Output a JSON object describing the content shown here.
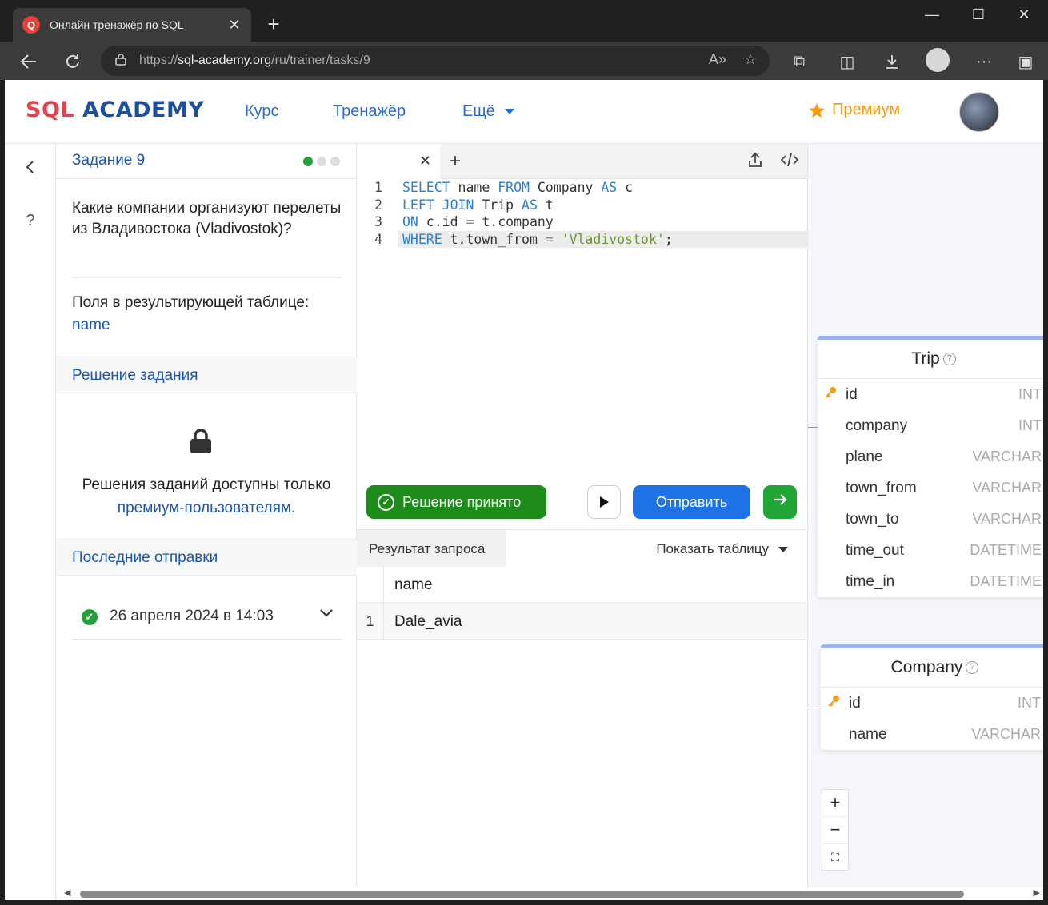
{
  "browser": {
    "tab_title": "Онлайн тренажёр по SQL",
    "url_prefix": "https://",
    "url_host": "sql-academy.org",
    "url_path": "/ru/trainer/tasks/9"
  },
  "header": {
    "logo_sql": "SQL",
    "logo_academy": "ACADEMY",
    "nav": {
      "course": "Курс",
      "trainer": "Тренажёр",
      "more": "Ещё"
    },
    "premium": "Премиум"
  },
  "rail": {
    "help": "?"
  },
  "task": {
    "title": "Задание 9",
    "progress": {
      "solved": 1,
      "total": 3
    },
    "question": "Какие компании организуют перелеты из Владивостока (Vladivostok)?",
    "fields_label": "Поля в результирующей таблице:",
    "fields_value": "name",
    "solution_header": "Решение задания",
    "premium_note_line1": "Решения заданий доступны только",
    "premium_note_link": "премиум-пользователям.",
    "recent_header": "Последние отправки",
    "submission_date": "26 апреля 2024 в 14:03"
  },
  "editor": {
    "lines": [
      {
        "n": "1",
        "tokens": [
          [
            "kw",
            "SELECT"
          ],
          [
            "t",
            " name "
          ],
          [
            "kw",
            "FROM"
          ],
          [
            "t",
            " Company "
          ],
          [
            "kw",
            "AS"
          ],
          [
            "t",
            " c"
          ]
        ]
      },
      {
        "n": "2",
        "tokens": [
          [
            "kw",
            "LEFT JOIN"
          ],
          [
            "t",
            " Trip "
          ],
          [
            "kw",
            "AS"
          ],
          [
            "t",
            " t"
          ]
        ]
      },
      {
        "n": "3",
        "tokens": [
          [
            "kw",
            "ON"
          ],
          [
            "t",
            " c.id "
          ],
          [
            "op",
            "="
          ],
          [
            "t",
            " t.company"
          ]
        ]
      },
      {
        "n": "4",
        "tokens": [
          [
            "kw",
            "WHERE"
          ],
          [
            "t",
            " t.town_from "
          ],
          [
            "op",
            "="
          ],
          [
            "t",
            " "
          ],
          [
            "str",
            "'Vladivostok'"
          ],
          [
            "t",
            ";"
          ]
        ]
      }
    ],
    "accepted_label": "Решение принято",
    "submit_label": "Отправить",
    "result_tab": "Результат запроса",
    "show_table": "Показать таблицу",
    "result_columns": [
      "name"
    ],
    "result_rows": [
      [
        "1",
        "Dale_avia"
      ]
    ]
  },
  "schema": {
    "tables": [
      {
        "name": "Trip",
        "columns": [
          {
            "name": "id",
            "type": "INT",
            "pk": true
          },
          {
            "name": "company",
            "type": "INT"
          },
          {
            "name": "plane",
            "type": "VARCHAR"
          },
          {
            "name": "town_from",
            "type": "VARCHAR"
          },
          {
            "name": "town_to",
            "type": "VARCHAR"
          },
          {
            "name": "time_out",
            "type": "DATETIME"
          },
          {
            "name": "time_in",
            "type": "DATETIME"
          }
        ]
      },
      {
        "name": "Company",
        "columns": [
          {
            "name": "id",
            "type": "INT",
            "pk": true
          },
          {
            "name": "name",
            "type": "VARCHAR"
          }
        ]
      }
    ],
    "zoom": {
      "in": "+",
      "out": "−"
    }
  },
  "colors": {
    "brand_red": "#e2434b",
    "brand_blue": "#1c4f9c",
    "link_blue": "#1c55b0",
    "success_green": "#1e8c1a",
    "submit_blue": "#1f72e4",
    "premium_orange": "#f59c0f"
  },
  "icons": [
    "back-icon",
    "refresh-icon",
    "lock-icon",
    "star-icon",
    "extensions-icon",
    "split-icon",
    "download-icon",
    "more-icon",
    "sidebar-icon",
    "chevron-left-icon",
    "help-icon",
    "close-icon",
    "plus-icon",
    "upload-icon",
    "code-icon",
    "play-icon",
    "arrow-right-icon",
    "check-icon",
    "chevron-down-icon",
    "key-icon",
    "fit-screen-icon"
  ]
}
